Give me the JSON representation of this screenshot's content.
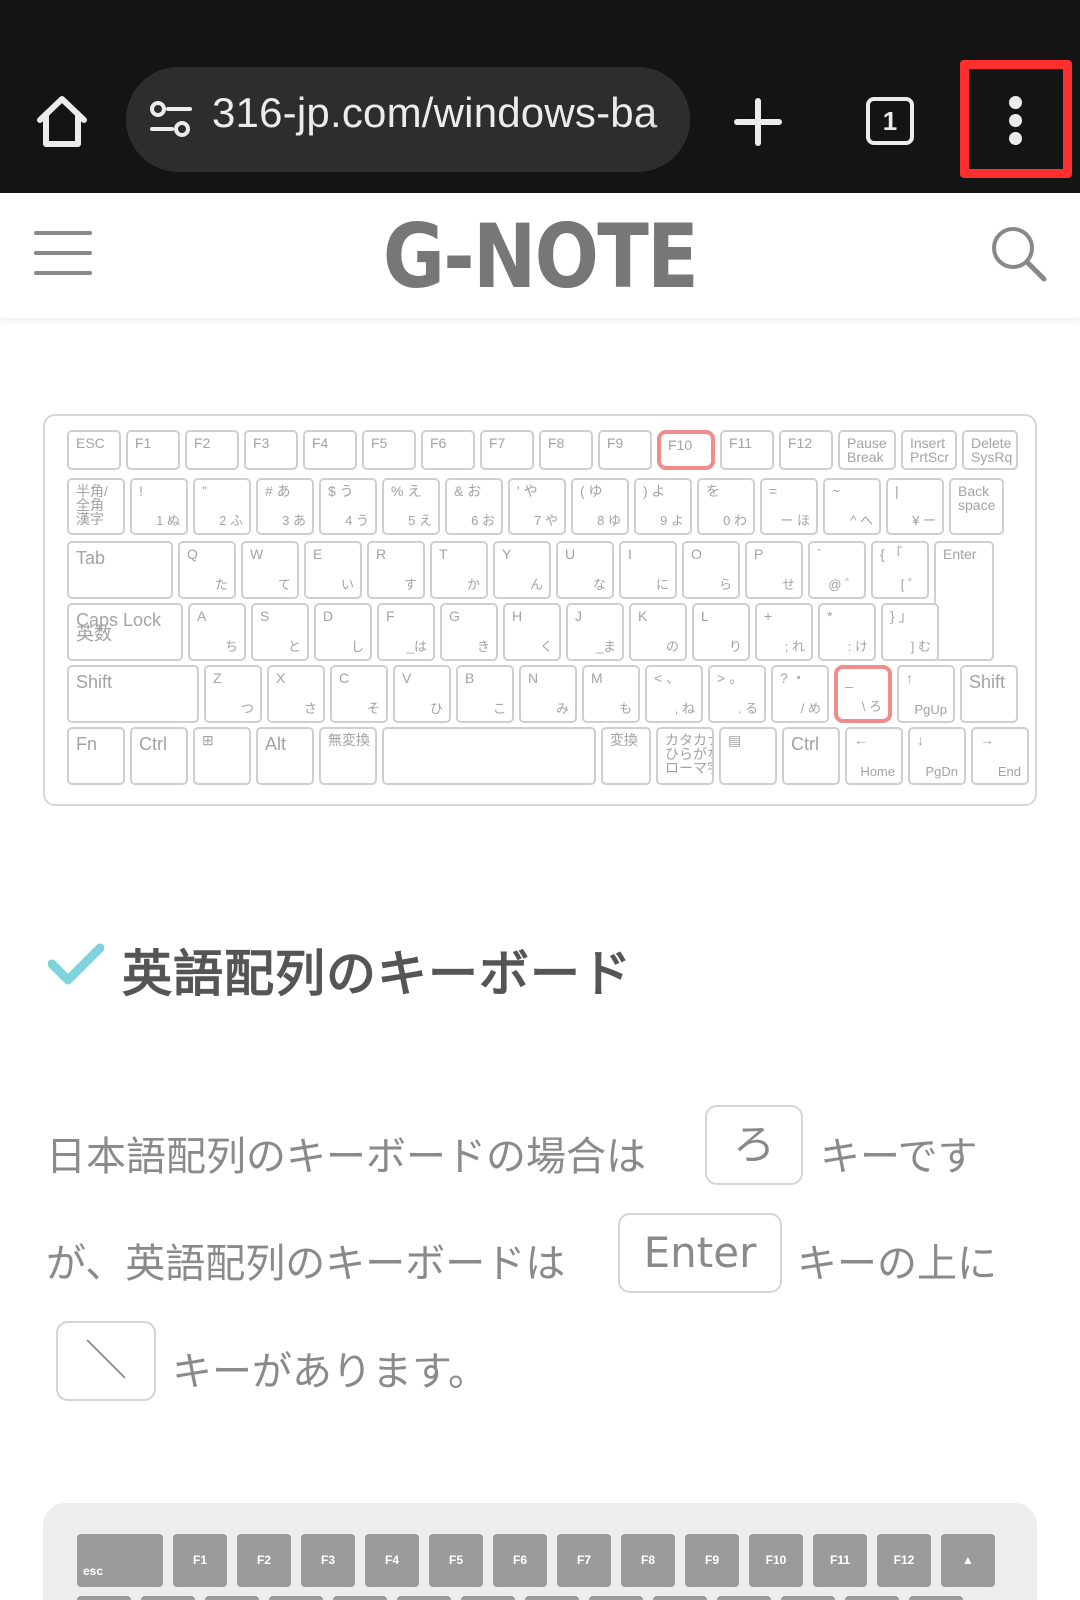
{
  "browser": {
    "url": "316-jp.com/windows-ba",
    "tab_count": "1",
    "icons": {
      "home": "home-icon",
      "site_info": "tune-icon",
      "new_tab": "plus-icon",
      "tabs": "tab-switcher-icon",
      "menu": "more-vert-icon"
    },
    "highlight_color": "#ff2f2f"
  },
  "site": {
    "logo": "G-NOTE",
    "icons": {
      "menu": "hamburger-icon",
      "search": "search-icon"
    }
  },
  "jp_keyboard": {
    "highlight_color": "#f08c8c",
    "rows": [
      [
        [
          "ESC",
          ""
        ],
        [
          "F1",
          ""
        ],
        [
          "F2",
          ""
        ],
        [
          "F3",
          ""
        ],
        [
          "F4",
          ""
        ],
        [
          "F5",
          ""
        ],
        [
          "F6",
          ""
        ],
        [
          "F7",
          ""
        ],
        [
          "F8",
          ""
        ],
        [
          "F9",
          ""
        ],
        [
          "F10",
          ""
        ],
        [
          "F11",
          ""
        ],
        [
          "F12",
          ""
        ],
        [
          "Pause\nBreak",
          ""
        ],
        [
          "Insert\nPrtScr",
          ""
        ],
        [
          "Delete\nSysRq",
          ""
        ]
      ],
      [
        [
          "半角/\n全角\n漢字",
          ""
        ],
        [
          "!",
          "1 ぬ"
        ],
        [
          "\"",
          "2 ふ"
        ],
        [
          "# あ",
          "3 あ"
        ],
        [
          "$ う",
          "4 う"
        ],
        [
          "% え",
          "5 え"
        ],
        [
          "& お",
          "6 お"
        ],
        [
          "' や",
          "7 や"
        ],
        [
          "( ゆ",
          "8 ゆ"
        ],
        [
          ") よ",
          "9 よ"
        ],
        [
          "を",
          "0 わ"
        ],
        [
          "=",
          "ー ほ"
        ],
        [
          "~",
          "^ へ"
        ],
        [
          "|",
          "¥ ー"
        ],
        [
          "Back\nspace",
          ""
        ]
      ],
      [
        [
          "Tab",
          ""
        ],
        [
          "Q",
          "た"
        ],
        [
          "W",
          "て"
        ],
        [
          "E",
          "い"
        ],
        [
          "R",
          "す"
        ],
        [
          "T",
          "か"
        ],
        [
          "Y",
          "ん"
        ],
        [
          "U",
          "な"
        ],
        [
          "I",
          "に"
        ],
        [
          "O",
          "ら"
        ],
        [
          "P",
          "せ"
        ],
        [
          "`",
          "@ ゛"
        ],
        [
          "{ 「",
          "[ ゜"
        ],
        [
          "Enter",
          ""
        ]
      ],
      [
        [
          "Caps Lock\n英数",
          ""
        ],
        [
          "A",
          "ち"
        ],
        [
          "S",
          "と"
        ],
        [
          "D",
          "し"
        ],
        [
          "F",
          "_は"
        ],
        [
          "G",
          "き"
        ],
        [
          "H",
          "く"
        ],
        [
          "J",
          "_ま"
        ],
        [
          "K",
          "の"
        ],
        [
          "L",
          "り"
        ],
        [
          "+",
          "; れ"
        ],
        [
          "*",
          ": け"
        ],
        [
          "} 」",
          "] む"
        ]
      ],
      [
        [
          "Shift",
          ""
        ],
        [
          "Z",
          "つ"
        ],
        [
          "X",
          "さ"
        ],
        [
          "C",
          "そ"
        ],
        [
          "V",
          "ひ"
        ],
        [
          "B",
          "こ"
        ],
        [
          "N",
          "み"
        ],
        [
          "M",
          "も"
        ],
        [
          "< 、",
          ", ね"
        ],
        [
          "> 。",
          ". る"
        ],
        [
          "? ・",
          "/ め"
        ],
        [
          "_",
          "\\ ろ"
        ],
        [
          "↑",
          "PgUp"
        ],
        [
          "Shift",
          ""
        ]
      ],
      [
        [
          "Fn",
          ""
        ],
        [
          "Ctrl",
          ""
        ],
        [
          "⊞",
          ""
        ],
        [
          "Alt",
          ""
        ],
        [
          "無変換",
          ""
        ],
        [
          "",
          ""
        ],
        [
          "変換",
          ""
        ],
        [
          "カタカナ\nひらがな\nローマ字",
          ""
        ],
        [
          "▤",
          ""
        ],
        [
          "Ctrl",
          ""
        ],
        [
          "←",
          "Home"
        ],
        [
          "↓",
          "PgDn"
        ],
        [
          "→",
          "End"
        ]
      ]
    ]
  },
  "heading": {
    "text": "英語配列のキーボード",
    "icon": "check-icon",
    "icon_color": "#7fd3dc"
  },
  "paragraph": {
    "l1_a": "日本語配列のキーボードの場合は",
    "key1": "ろ",
    "l1_b": "キーです",
    "l2_a": "が、英語配列のキーボードは",
    "key2": "Enter",
    "l2_b": "キーの上に",
    "key3": "＼",
    "l3_b": "キーがあります。"
  },
  "us_keyboard": {
    "keys": [
      "esc",
      "F1",
      "F2",
      "F3",
      "F4",
      "F5",
      "F6",
      "F7",
      "F8",
      "F9",
      "F10",
      "F11",
      "F12",
      "▲"
    ]
  }
}
